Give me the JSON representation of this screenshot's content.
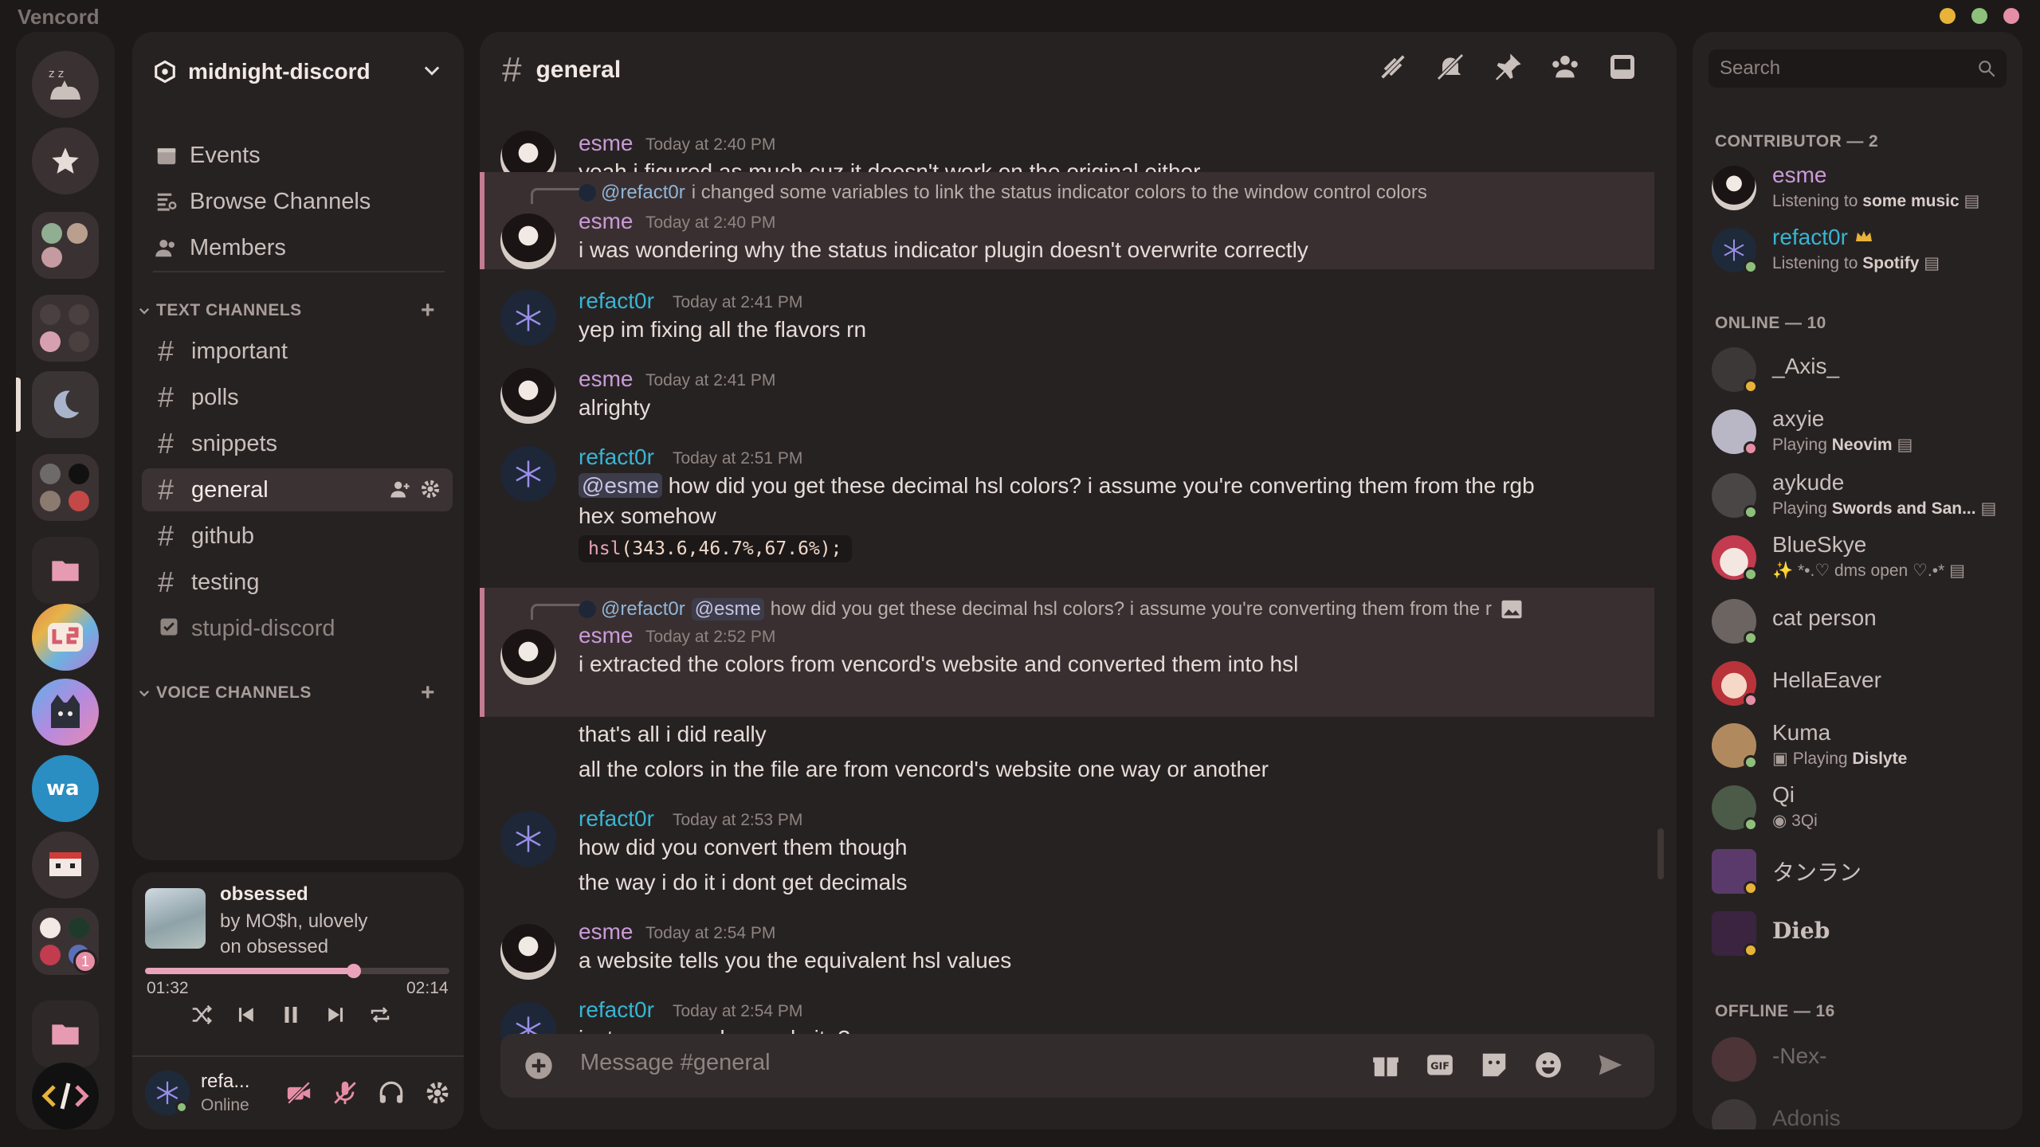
{
  "window": {
    "title": "Vencord",
    "controls": [
      "minimize",
      "maximize",
      "close"
    ],
    "control_colors": [
      "#e8b339",
      "#8ec07c",
      "#e58ea5"
    ]
  },
  "server": {
    "name": "midnight-discord",
    "nav": [
      "Events",
      "Browse Channels",
      "Members"
    ],
    "text_category": "TEXT CHANNELS",
    "voice_category": "VOICE CHANNELS",
    "channels": [
      "important",
      "polls",
      "snippets",
      "general",
      "github",
      "testing",
      "stupid-discord"
    ],
    "active_channel": "general"
  },
  "player": {
    "song": "obsessed",
    "artist": "by MO$h, ulovely",
    "album": "on obsessed",
    "elapsed": "01:32",
    "duration": "02:14",
    "progress": 0.687
  },
  "user": {
    "name": "refa...",
    "status": "Online"
  },
  "chat": {
    "channel": "general",
    "placeholder": "Message #general",
    "messages": [
      {
        "author": "esme",
        "time": "Today at 2:40 PM",
        "text": "yeah i figured as much cuz it doesn't work on the original either"
      },
      {
        "reply_to": "@refact0r",
        "reply_text": "i changed some variables to link the status indicator colors to the window control colors",
        "author": "esme",
        "time": "Today at 2:40 PM",
        "text": "i was wondering why the status indicator plugin doesn't overwrite correctly"
      },
      {
        "author": "refact0r",
        "time": "Today at 2:41 PM",
        "text": "yep im fixing all the flavors rn"
      },
      {
        "author": "esme",
        "time": "Today at 2:41 PM",
        "text": "alrighty"
      },
      {
        "author": "refact0r",
        "time": "Today at 2:51 PM",
        "mention": "@esme",
        "text": "how did you get these decimal hsl colors? i assume you're converting them from the rgb",
        "text2": "hex somehow",
        "code_fn": "hsl",
        "code_args": "(343.6,46.7%,67.6%);"
      },
      {
        "reply_to": "@refact0r",
        "reply_mention": "@esme",
        "reply_text": "how did you get these decimal hsl colors? i assume you're converting them from the r",
        "author": "esme",
        "time": "Today at 2:52 PM",
        "text": "i extracted the colors from vencord's website and converted them into hsl",
        "text2": "that's all i did really",
        "text3": "all the colors in the file are from vencord's website one way or another"
      },
      {
        "author": "refact0r",
        "time": "Today at 2:53 PM",
        "text": "how did you convert them though",
        "text2": "the way i do it i dont get decimals"
      },
      {
        "author": "esme",
        "time": "Today at 2:54 PM",
        "text": "a website tells you the equivalent hsl values"
      },
      {
        "author": "refact0r",
        "time": "Today at 2:54 PM",
        "text": "just some random website?"
      }
    ]
  },
  "members": {
    "search_placeholder": "Search",
    "contributor_header": "CONTRIBUTOR — 2",
    "online_header": "ONLINE — 10",
    "offline_header": "OFFLINE — 16",
    "contributors": [
      {
        "name": "esme",
        "activity_prefix": "Listening to",
        "activity": "some music"
      },
      {
        "name": "refact0r",
        "activity_prefix": "Listening to",
        "activity": "Spotify"
      }
    ],
    "online": [
      {
        "name": "_Axis_"
      },
      {
        "name": "axyie",
        "activity_prefix": "Playing",
        "activity": "Neovim"
      },
      {
        "name": "aykude",
        "activity_prefix": "Playing",
        "activity": "Swords and San..."
      },
      {
        "name": "BlueSkye",
        "activity": "✨ *•.♡ dms open ♡.•*"
      },
      {
        "name": "cat person"
      },
      {
        "name": "HellaEaver"
      },
      {
        "name": "Kuma",
        "activity_prefix": "Playing",
        "activity": "Dislyte"
      },
      {
        "name": "Qi",
        "activity": "3Qi"
      },
      {
        "name": "タンラン"
      },
      {
        "name": "Dieb"
      }
    ],
    "offline": [
      {
        "name": "-Nex-"
      },
      {
        "name": "Adonis"
      }
    ]
  },
  "badges": {
    "folder_unread": "1"
  }
}
